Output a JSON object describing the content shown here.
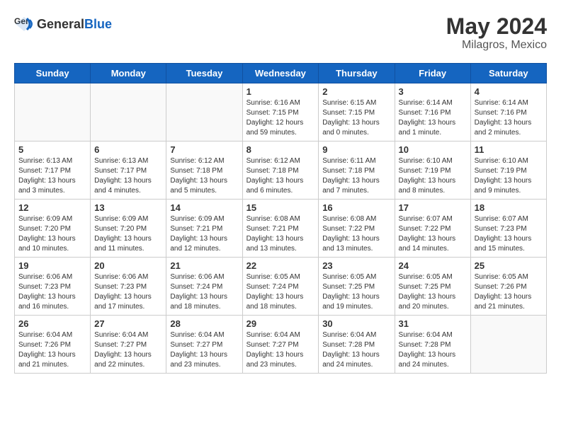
{
  "header": {
    "logo_general": "General",
    "logo_blue": "Blue",
    "month_year": "May 2024",
    "location": "Milagros, Mexico"
  },
  "weekdays": [
    "Sunday",
    "Monday",
    "Tuesday",
    "Wednesday",
    "Thursday",
    "Friday",
    "Saturday"
  ],
  "weeks": [
    [
      {
        "day": "",
        "info": ""
      },
      {
        "day": "",
        "info": ""
      },
      {
        "day": "",
        "info": ""
      },
      {
        "day": "1",
        "info": "Sunrise: 6:16 AM\nSunset: 7:15 PM\nDaylight: 12 hours\nand 59 minutes."
      },
      {
        "day": "2",
        "info": "Sunrise: 6:15 AM\nSunset: 7:15 PM\nDaylight: 13 hours\nand 0 minutes."
      },
      {
        "day": "3",
        "info": "Sunrise: 6:14 AM\nSunset: 7:16 PM\nDaylight: 13 hours\nand 1 minute."
      },
      {
        "day": "4",
        "info": "Sunrise: 6:14 AM\nSunset: 7:16 PM\nDaylight: 13 hours\nand 2 minutes."
      }
    ],
    [
      {
        "day": "5",
        "info": "Sunrise: 6:13 AM\nSunset: 7:17 PM\nDaylight: 13 hours\nand 3 minutes."
      },
      {
        "day": "6",
        "info": "Sunrise: 6:13 AM\nSunset: 7:17 PM\nDaylight: 13 hours\nand 4 minutes."
      },
      {
        "day": "7",
        "info": "Sunrise: 6:12 AM\nSunset: 7:18 PM\nDaylight: 13 hours\nand 5 minutes."
      },
      {
        "day": "8",
        "info": "Sunrise: 6:12 AM\nSunset: 7:18 PM\nDaylight: 13 hours\nand 6 minutes."
      },
      {
        "day": "9",
        "info": "Sunrise: 6:11 AM\nSunset: 7:18 PM\nDaylight: 13 hours\nand 7 minutes."
      },
      {
        "day": "10",
        "info": "Sunrise: 6:10 AM\nSunset: 7:19 PM\nDaylight: 13 hours\nand 8 minutes."
      },
      {
        "day": "11",
        "info": "Sunrise: 6:10 AM\nSunset: 7:19 PM\nDaylight: 13 hours\nand 9 minutes."
      }
    ],
    [
      {
        "day": "12",
        "info": "Sunrise: 6:09 AM\nSunset: 7:20 PM\nDaylight: 13 hours\nand 10 minutes."
      },
      {
        "day": "13",
        "info": "Sunrise: 6:09 AM\nSunset: 7:20 PM\nDaylight: 13 hours\nand 11 minutes."
      },
      {
        "day": "14",
        "info": "Sunrise: 6:09 AM\nSunset: 7:21 PM\nDaylight: 13 hours\nand 12 minutes."
      },
      {
        "day": "15",
        "info": "Sunrise: 6:08 AM\nSunset: 7:21 PM\nDaylight: 13 hours\nand 13 minutes."
      },
      {
        "day": "16",
        "info": "Sunrise: 6:08 AM\nSunset: 7:22 PM\nDaylight: 13 hours\nand 13 minutes."
      },
      {
        "day": "17",
        "info": "Sunrise: 6:07 AM\nSunset: 7:22 PM\nDaylight: 13 hours\nand 14 minutes."
      },
      {
        "day": "18",
        "info": "Sunrise: 6:07 AM\nSunset: 7:23 PM\nDaylight: 13 hours\nand 15 minutes."
      }
    ],
    [
      {
        "day": "19",
        "info": "Sunrise: 6:06 AM\nSunset: 7:23 PM\nDaylight: 13 hours\nand 16 minutes."
      },
      {
        "day": "20",
        "info": "Sunrise: 6:06 AM\nSunset: 7:23 PM\nDaylight: 13 hours\nand 17 minutes."
      },
      {
        "day": "21",
        "info": "Sunrise: 6:06 AM\nSunset: 7:24 PM\nDaylight: 13 hours\nand 18 minutes."
      },
      {
        "day": "22",
        "info": "Sunrise: 6:05 AM\nSunset: 7:24 PM\nDaylight: 13 hours\nand 18 minutes."
      },
      {
        "day": "23",
        "info": "Sunrise: 6:05 AM\nSunset: 7:25 PM\nDaylight: 13 hours\nand 19 minutes."
      },
      {
        "day": "24",
        "info": "Sunrise: 6:05 AM\nSunset: 7:25 PM\nDaylight: 13 hours\nand 20 minutes."
      },
      {
        "day": "25",
        "info": "Sunrise: 6:05 AM\nSunset: 7:26 PM\nDaylight: 13 hours\nand 21 minutes."
      }
    ],
    [
      {
        "day": "26",
        "info": "Sunrise: 6:04 AM\nSunset: 7:26 PM\nDaylight: 13 hours\nand 21 minutes."
      },
      {
        "day": "27",
        "info": "Sunrise: 6:04 AM\nSunset: 7:27 PM\nDaylight: 13 hours\nand 22 minutes."
      },
      {
        "day": "28",
        "info": "Sunrise: 6:04 AM\nSunset: 7:27 PM\nDaylight: 13 hours\nand 23 minutes."
      },
      {
        "day": "29",
        "info": "Sunrise: 6:04 AM\nSunset: 7:27 PM\nDaylight: 13 hours\nand 23 minutes."
      },
      {
        "day": "30",
        "info": "Sunrise: 6:04 AM\nSunset: 7:28 PM\nDaylight: 13 hours\nand 24 minutes."
      },
      {
        "day": "31",
        "info": "Sunrise: 6:04 AM\nSunset: 7:28 PM\nDaylight: 13 hours\nand 24 minutes."
      },
      {
        "day": "",
        "info": ""
      }
    ]
  ]
}
